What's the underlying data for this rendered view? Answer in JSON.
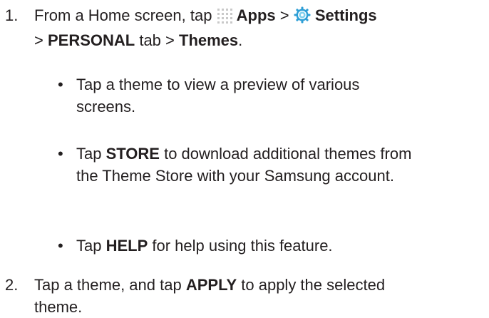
{
  "step1": {
    "number": "1.",
    "text_a": "From a Home screen, tap ",
    "apps_icon": "apps-grid-icon",
    "apps": "Apps",
    "sep1": " > ",
    "settings_icon": "settings-gear-icon",
    "settings": "Settings",
    "sep2": "> ",
    "personal": "PERSONAL",
    "text_b": " tab > ",
    "themes": "Themes",
    "period": "."
  },
  "bullets": [
    {
      "dot": "•",
      "text": "Tap a theme to view a preview of various screens."
    },
    {
      "dot": "•",
      "pre": "Tap ",
      "bold": "STORE",
      "post": " to download additional themes from the Theme Store with your Samsung account."
    },
    {
      "dot": "•",
      "pre": "Tap ",
      "bold": "HELP",
      "post": " for help using this feature."
    }
  ],
  "step2": {
    "number": "2.",
    "pre": "Tap a theme, and tap ",
    "bold": "APPLY",
    "post": " to apply the selected theme."
  },
  "colors": {
    "text": "#231f20",
    "icon_grid": "#c9c9c9",
    "icon_gear_ring": "#2f9fd6",
    "icon_gear_center": "#7fd0ee"
  }
}
